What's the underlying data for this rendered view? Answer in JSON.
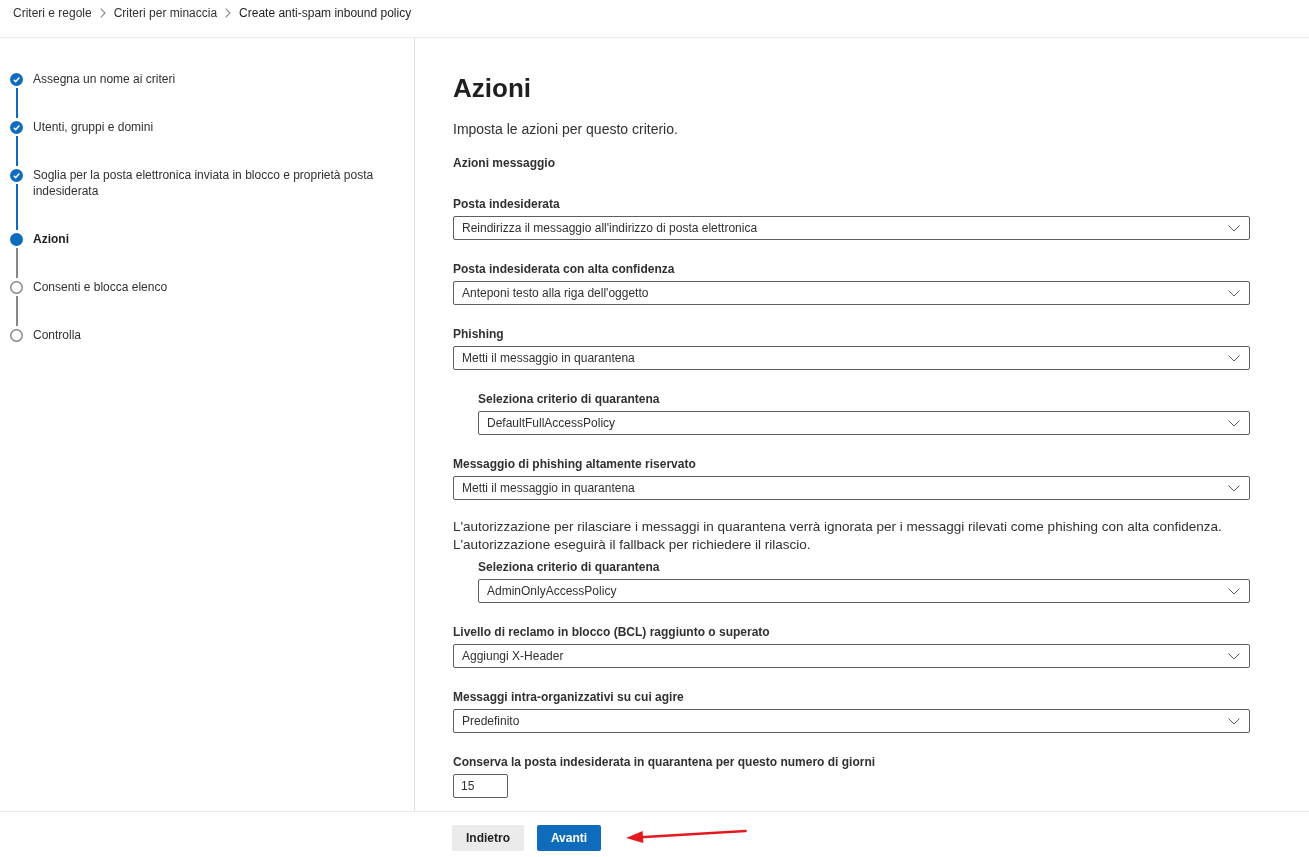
{
  "breadcrumb": [
    {
      "label": "Criteri e regole"
    },
    {
      "label": "Criteri per minaccia"
    },
    {
      "label": "Create anti-spam inbound policy"
    }
  ],
  "steps": [
    {
      "label": "Assegna un nome ai criteri",
      "completed": true,
      "selected": false
    },
    {
      "label": "Utenti, gruppi e domini",
      "completed": true,
      "selected": false
    },
    {
      "label": "Soglia per la posta elettronica inviata in blocco e proprietà posta indesiderata",
      "completed": true,
      "selected": false
    },
    {
      "label": "Azioni",
      "completed": false,
      "selected": true
    },
    {
      "label": "Consenti e blocca elenco",
      "completed": false,
      "selected": false
    },
    {
      "label": "Controlla",
      "completed": false,
      "selected": false
    }
  ],
  "page": {
    "title": "Azioni",
    "description": "Imposta le azioni per questo criterio.",
    "section": "Azioni messaggio"
  },
  "fields": [
    {
      "kind": "select",
      "label": "Posta indesiderata",
      "value": "Reindirizza il messaggio all'indirizzo di posta elettronica"
    },
    {
      "kind": "select",
      "label": "Posta indesiderata con alta confidenza",
      "value": "Anteponi testo alla riga dell'oggetto"
    },
    {
      "kind": "select",
      "label": "Phishing",
      "value": "Metti il messaggio in quarantena",
      "children": [
        {
          "kind": "select",
          "label": "Seleziona criterio di quarantena",
          "value": "DefaultFullAccessPolicy"
        }
      ]
    },
    {
      "kind": "select",
      "label": "Messaggio di phishing altamente riservato",
      "value": "Metti il messaggio in quarantena",
      "note": "L'autorizzazione per rilasciare i messaggi in quarantena verrà ignorata per i messaggi rilevati come phishing con alta confidenza.\nL'autorizzazione eseguirà il fallback per richiedere il rilascio.",
      "children": [
        {
          "kind": "select",
          "label": "Seleziona criterio di quarantena",
          "value": "AdminOnlyAccessPolicy"
        }
      ]
    },
    {
      "kind": "select",
      "label": "Livello di reclamo in blocco (BCL) raggiunto o superato",
      "value": "Aggiungi X-Header"
    },
    {
      "kind": "select",
      "label": "Messaggi intra-organizzativi su cui agire",
      "value": "Predefinito"
    },
    {
      "kind": "number",
      "label": "Conserva la posta indesiderata in quarantena per questo numero di giorni",
      "value": "15"
    }
  ],
  "buttons": [
    {
      "label": "Indietro",
      "kind": "secondary"
    },
    {
      "label": "Avanti",
      "kind": "primary"
    }
  ]
}
